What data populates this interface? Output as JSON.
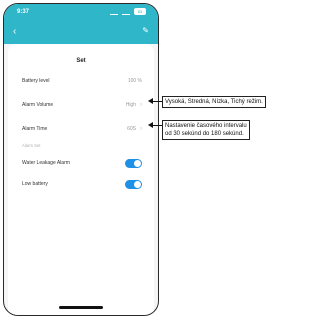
{
  "status": {
    "time": "9:37",
    "battery": "83"
  },
  "screen": {
    "title": "Set",
    "rows": [
      {
        "label": "Battery level",
        "value": "100 %"
      },
      {
        "label": "Alarm Volume",
        "value": "High"
      },
      {
        "label": "Alarm Time",
        "value": "60S"
      }
    ],
    "section_label": "Alarm Set",
    "toggles": [
      {
        "label": "Water Leakage Alarm",
        "on": true
      },
      {
        "label": "Low battery",
        "on": true
      }
    ]
  },
  "annotations": {
    "volume": "Vysoká, Stredná, Nízka, Tichý režim.",
    "time_line1": "Nastavenie časového intervalu",
    "time_line2": "od 30 sekúnd do 180 sekúnd."
  },
  "colors": {
    "header": "#2fb6c8",
    "toggle": "#1e90e6"
  }
}
